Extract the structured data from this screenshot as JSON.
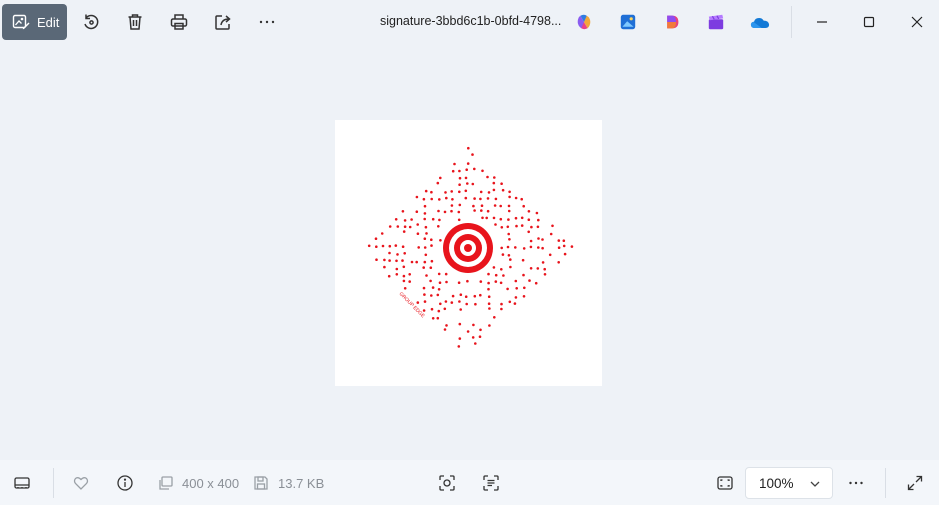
{
  "toolbar": {
    "edit_label": "Edit",
    "tools": [
      "rotate-icon",
      "delete-icon",
      "print-icon",
      "share-icon",
      "more-icon"
    ]
  },
  "file": {
    "name": "signature-3bbd6c1b-0bfd-4798..."
  },
  "apps": [
    "copilot-icon",
    "photos-app-icon",
    "designer-icon",
    "clipchamp-icon",
    "onedrive-icon"
  ],
  "image": {
    "caption": "GROUP EDGE",
    "accent_color": "#e8141c"
  },
  "status": {
    "dimensions": "400 x 400",
    "file_size": "13.7 KB",
    "zoom": "100%"
  }
}
